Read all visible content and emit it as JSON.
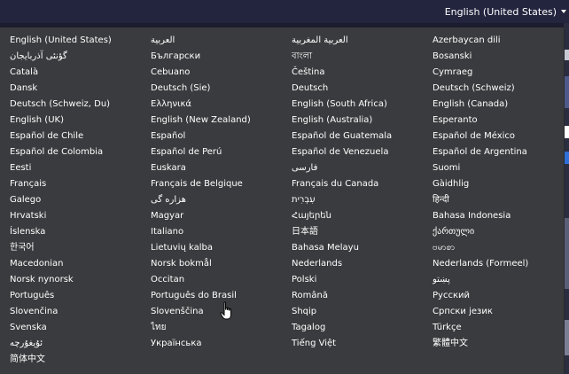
{
  "header": {
    "current_language": "English (United States)"
  },
  "languages": [
    "English (United States)",
    "العربية",
    "العربية المغربية",
    "Azerbaycan dili",
    "گؤنئی آذربایجان",
    "Български",
    "বাংলা",
    "Bosanski",
    "Català",
    "Cebuano",
    "Čeština",
    "Cymraeg",
    "Dansk",
    "Deutsch (Sie)",
    "Deutsch",
    "Deutsch (Schweiz)",
    "Deutsch (Schweiz, Du)",
    "Ελληνικά",
    "English (South Africa)",
    "English (Canada)",
    "English (UK)",
    "English (New Zealand)",
    "English (Australia)",
    "Esperanto",
    "Español de Chile",
    "Español",
    "Español de Guatemala",
    "Español de México",
    "Español de Colombia",
    "Español de Perú",
    "Español de Venezuela",
    "Español de Argentina",
    "Eesti",
    "Euskara",
    "فارسی",
    "Suomi",
    "Français",
    "Français de Belgique",
    "Français du Canada",
    "Gàidhlig",
    "Galego",
    "هزاره گی",
    "עִבְרִית",
    "हिन्दी",
    "Hrvatski",
    "Magyar",
    "Հայերեն",
    "Bahasa Indonesia",
    "Íslenska",
    "Italiano",
    "日本語",
    "ქართული",
    "한국어",
    "Lietuvių kalba",
    "Bahasa Melayu",
    "ဗမာစာ",
    "Macedonian",
    "Norsk bokmål",
    "Nederlands",
    "Nederlands (Formeel)",
    "Norsk nynorsk",
    "Occitan",
    "Polski",
    "پښتو",
    "Português",
    "Português do Brasil",
    "Română",
    "Русский",
    "Slovenčina",
    "Slovenščina",
    "Shqip",
    "Српски језик",
    "Svenska",
    "ไทย",
    "Tagalog",
    "Türkçe",
    "ئۇيغۇرچە",
    "Українська",
    "Tiếng Việt",
    "繁體中文",
    "简体中文"
  ],
  "colors": {
    "dropdown_bg": "#3a3b3e",
    "topbar_bg": "#23253f",
    "text": "#ffffff"
  },
  "icons": {
    "caret": "caret-down-icon",
    "cursor": "hand-pointer-cursor"
  }
}
